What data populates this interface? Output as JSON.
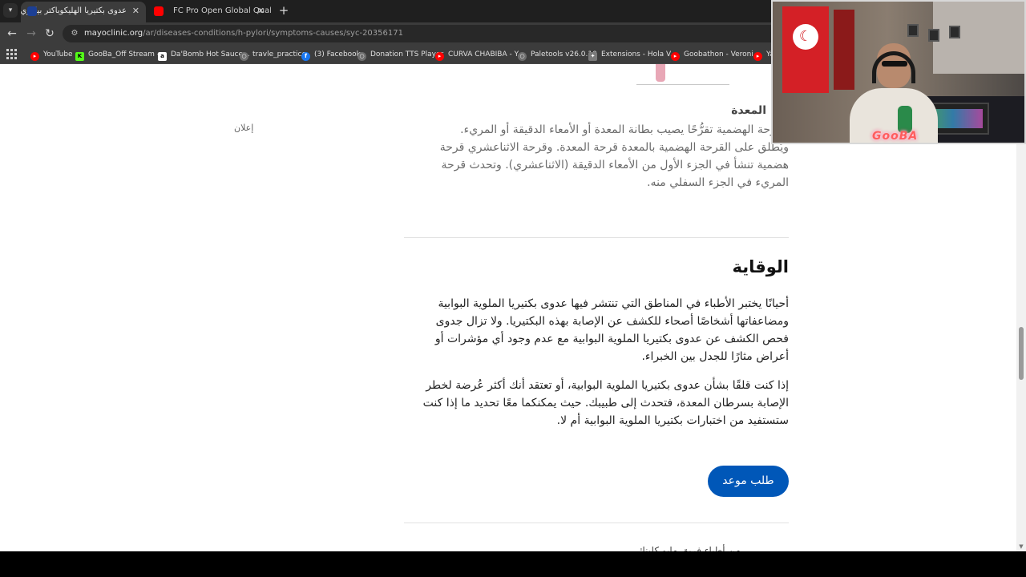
{
  "browser": {
    "tabs": [
      {
        "title": "عدوى بكتيريا الهليكوباكتر بيلوري",
        "active": true
      },
      {
        "title": "FC Pro Open Global Qualifier -",
        "active": false
      }
    ],
    "new_tab": "+",
    "close": "✕",
    "url_host": "mayoclinic.org",
    "url_path": "/ar/diseases-conditions/h-pylori/symptoms-causes/syc-20356171",
    "bookmarks": [
      {
        "label": "YouTube",
        "icon": "youtube-icon",
        "color": "#ff0000"
      },
      {
        "label": "GooBa_Off Stream -...",
        "icon": "kick-icon",
        "color": "#53fc18"
      },
      {
        "label": "Da'Bomb Hot Sauce...",
        "icon": "amazon-icon",
        "color": "#ffffff"
      },
      {
        "label": "travle_practice",
        "icon": "globe-icon",
        "color": "#9e9e9e"
      },
      {
        "label": "(3) Facebook",
        "icon": "facebook-icon",
        "color": "#1877f2"
      },
      {
        "label": "Donation TTS Player",
        "icon": "globe-icon",
        "color": "#9e9e9e"
      },
      {
        "label": "CURVA CHABIBA - Y...",
        "icon": "youtube-icon",
        "color": "#ff0000"
      },
      {
        "label": "Paletools v26.0.10",
        "icon": "globe-icon",
        "color": "#9e9e9e"
      },
      {
        "label": "Extensions - Hola V...",
        "icon": "puzzle-icon",
        "color": "#bdbdbd"
      },
      {
        "label": "Goobathon - Veroni...",
        "icon": "youtube-icon",
        "color": "#ff0000"
      },
      {
        "label": "Ya",
        "icon": "youtube-icon",
        "color": "#ff0000"
      }
    ]
  },
  "page": {
    "ad_label": "إعلان",
    "ulcer": {
      "heading": "المعدة",
      "text": "القرحة الهضمية تقرُّحًا يصيب بطانة المعدة أو الأمعاء الدقيقة أو المريء. ويُطلق على القرحة الهضمية بالمعدة قرحة المعدة. وقرحة الاثناعشري قرحة هضمية تنشأ في الجزء الأول من الأمعاء الدقيقة (الاثناعشري). وتحدث قرحة المريء في الجزء السفلي منه."
    },
    "prevention": {
      "title": "الوقاية",
      "para1": "أحيانًا يختبر الأطباء في المناطق التي تنتشر فيها عدوى بكتيريا الملوية البوابية ومضاعفاتها أشخاصًا أصحاء للكشف عن الإصابة بهذه البكتيريا. ولا تزال جدوى فحص الكشف عن عدوى بكتيريا الملوية البوابية مع عدم وجود أي مؤشرات أو أعراض مثارًا للجدل بين الخبراء.",
      "para2": "إذا كنت قلقًا بشأن عدوى بكتيريا الملوية البوابية، أو تعتقد أنك أكثر عُرضة لخطر الإصابة بسرطان المعدة، فتحدث إلى طبيبك. حيث يمكنكما معًا تحديد ما إذا كنت ستستفيد من اختبارات بكتيريا الملوية البوابية أم لا.",
      "cta": "طلب موعد"
    },
    "cut_text": "من أطباء فريق مايو كلينك"
  },
  "webcam": {
    "logo": "GooBA"
  }
}
